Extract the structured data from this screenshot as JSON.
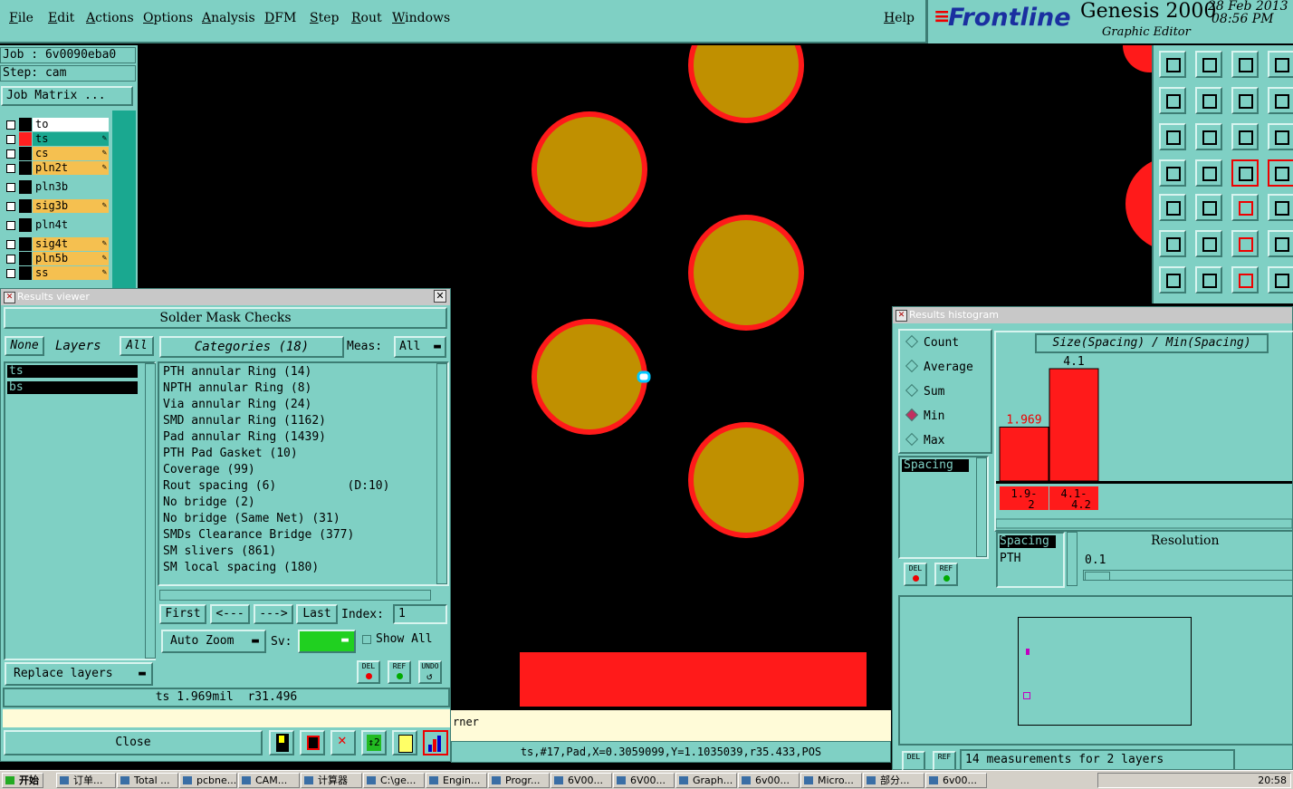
{
  "menu": {
    "items": [
      "File",
      "Edit",
      "Actions",
      "Options",
      "Analysis",
      "DFM",
      "Step",
      "Rout",
      "Windows"
    ],
    "help": "Help"
  },
  "brand": {
    "logo": "Frontline",
    "product": "Genesis 2000",
    "subtitle": "Graphic Editor",
    "date": "28 Feb 2013",
    "time": "08:56 PM"
  },
  "job": {
    "job_line": "Job : 6v0090eba0",
    "step_line": "Step: cam",
    "matrix_button": "Job Matrix ..."
  },
  "layers": [
    {
      "name": "to",
      "color": "#ffffff",
      "swatch": "#000000",
      "editable": false
    },
    {
      "name": "ts",
      "color": "#1aa890",
      "swatch": "#ff2020",
      "editable": true
    },
    {
      "name": "cs",
      "color": "#f5c050",
      "swatch": "#000000",
      "editable": true
    },
    {
      "name": "pln2t",
      "color": "#f5c050",
      "swatch": "#000000",
      "editable": true
    },
    {
      "name": "pln3b",
      "color": "#7fd0c4",
      "swatch": "#000000",
      "editable": false
    },
    {
      "name": "sig3b",
      "color": "#f5c050",
      "swatch": "#000000",
      "editable": true
    },
    {
      "name": "pln4t",
      "color": "#7fd0c4",
      "swatch": "#000000",
      "editable": false
    },
    {
      "name": "sig4t",
      "color": "#f5c050",
      "swatch": "#000000",
      "editable": true
    },
    {
      "name": "pln5b",
      "color": "#f5c050",
      "swatch": "#000000",
      "editable": true
    },
    {
      "name": "ss",
      "color": "#f5c050",
      "swatch": "#000000",
      "editable": true
    }
  ],
  "results_viewer": {
    "title": "Results viewer",
    "header": "Solder Mask Checks",
    "none_btn": "None",
    "layers_label": "Layers",
    "all_btn": "All",
    "layer_items": [
      "ts",
      "bs"
    ],
    "categories_label": "Categories (18)",
    "meas_label": "Meas:",
    "meas_value": "All",
    "categories": [
      "PTH annular Ring (14)",
      "NPTH annular Ring (8)",
      "Via annular Ring (24)",
      "SMD annular Ring (1162)",
      "Pad annular Ring (1439)",
      "PTH Pad Gasket (10)",
      "Coverage (99)",
      "Rout spacing (6)          (D:10)",
      "No bridge (2)",
      "No bridge (Same Net) (31)",
      "SMDs Clearance Bridge (377)",
      "SM slivers (861)",
      "SM local spacing (180)"
    ],
    "first_btn": "First",
    "prev_btn": "<---",
    "next_btn": "--->",
    "last_btn": "Last",
    "index_label": "Index:",
    "index_value": "1",
    "auto_zoom": "Auto Zoom",
    "sv_label": "Sv:",
    "show_all": "Show All",
    "replace_layers": "Replace layers",
    "status": "ts 1.969mil  r31.496",
    "close": "Close",
    "del": "DEL",
    "ref": "REF",
    "undo": "UNDO"
  },
  "canvas": {
    "status_line": "ts,#17,Pad,X=0.3059099,Y=1.1035039,r35.433,POS",
    "hint_fragment": "rner",
    "pad_fill": "#c09000",
    "ring": "#ff1a1a"
  },
  "histogram": {
    "title": "Results histogram",
    "modes": [
      "Count",
      "Average",
      "Sum",
      "Min",
      "Max"
    ],
    "selected_mode": "Min",
    "measure_item": "Spacing",
    "chart_title": "Size(Spacing) / Min(Spacing)",
    "res_list": [
      "Spacing",
      "PTH"
    ],
    "resolution_label": "Resolution",
    "resolution_value": "0.1",
    "footer": "14 measurements for 2 layers",
    "del": "DEL",
    "ref": "REF"
  },
  "chart_data": {
    "type": "bar",
    "title": "Size(Spacing) / Min(Spacing)",
    "categories": [
      "1.9-2",
      "4.1-4.2"
    ],
    "values": [
      1.969,
      4.1
    ],
    "value_labels": [
      "1.969",
      "4.1"
    ],
    "bar_color": "#ff1a1a"
  },
  "taskbar": {
    "start": "开始",
    "tasks": [
      "订单...",
      "Total ...",
      "pcbne...",
      "CAM...",
      "计算器",
      "C:\\ge...",
      "Engin...",
      "Progr...",
      "6V00...",
      "6V00...",
      "Graph...",
      "6v00...",
      "Micro...",
      "部分...",
      "6v00..."
    ],
    "clock": "20:58"
  }
}
